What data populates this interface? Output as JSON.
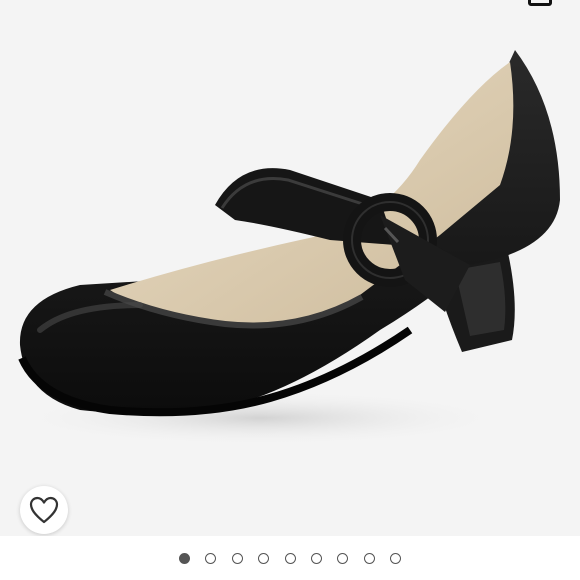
{
  "listing": {
    "image": {
      "subject_icon": "mary-jane-shoe-photo",
      "background_color": "#f4f4f4"
    },
    "like_button": {
      "icon": "heart-outline-icon",
      "state": "not-liked"
    },
    "top_corner_icon": "partial-icon-cropped",
    "carousel": {
      "total_images": 9,
      "active_index": 0
    }
  }
}
